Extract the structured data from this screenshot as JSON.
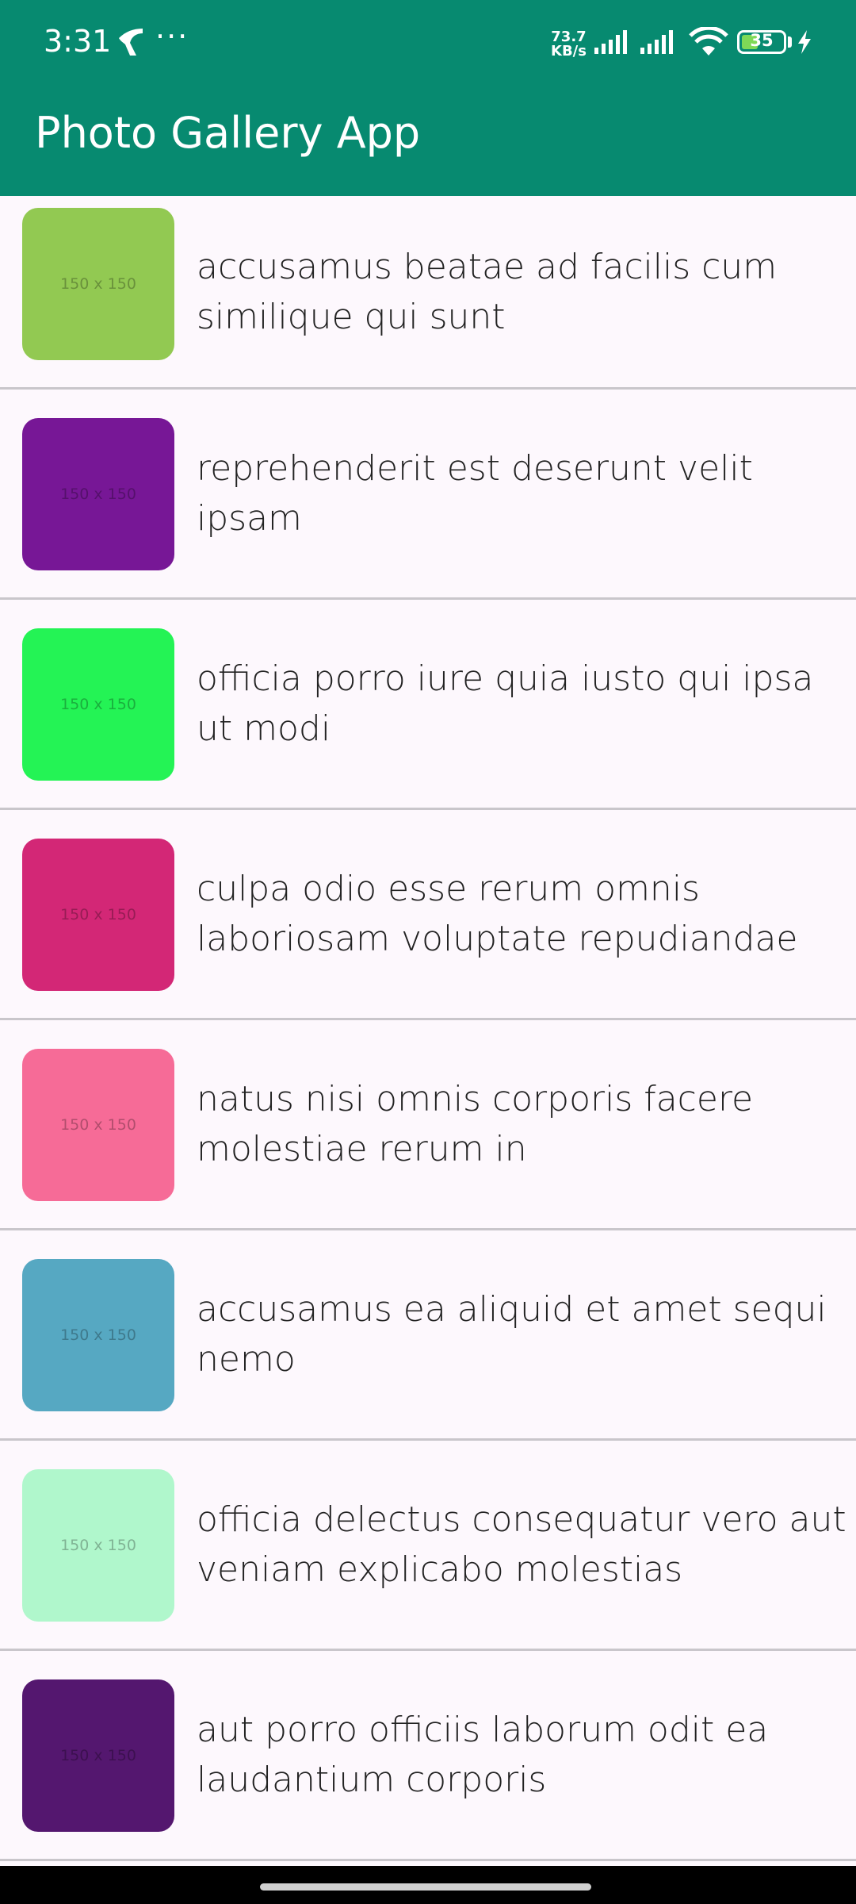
{
  "status_bar": {
    "time": "3:31",
    "net_speed_value": "73.7",
    "net_speed_unit": "KB/s",
    "battery": "35",
    "more": "···"
  },
  "app_bar": {
    "title": "Photo Gallery App"
  },
  "photos": [
    {
      "title": "accusamus beatae ad facilis cum similique qui sunt",
      "thumb_label": "150 x 150",
      "color": "#92c952"
    },
    {
      "title": "reprehenderit est deserunt velit ipsam",
      "thumb_label": "150 x 150",
      "color": "#771796"
    },
    {
      "title": "officia porro iure quia iusto qui ipsa ut modi",
      "thumb_label": "150 x 150",
      "color": "#24f355"
    },
    {
      "title": "culpa odio esse rerum omnis laboriosam voluptate repudiandae",
      "thumb_label": "150 x 150",
      "color": "#d32776"
    },
    {
      "title": "natus nisi omnis corporis facere molestiae rerum in",
      "thumb_label": "150 x 150",
      "color": "#f66b97"
    },
    {
      "title": "accusamus ea aliquid et amet sequi nemo",
      "thumb_label": "150 x 150",
      "color": "#56a8c2"
    },
    {
      "title": "officia delectus consequatur vero aut veniam explicabo molestias",
      "thumb_label": "150 x 150",
      "color": "#b0f7cc"
    },
    {
      "title": "aut porro officiis laborum odit ea laudantium corporis",
      "thumb_label": "150 x 150",
      "color": "#54176f"
    }
  ]
}
